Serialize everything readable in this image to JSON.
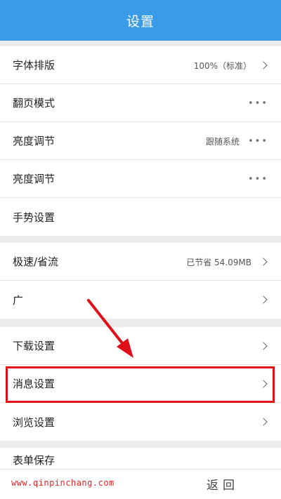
{
  "header": {
    "title": "设置"
  },
  "group1": [
    {
      "label": "字体排版",
      "value": "100%（标准）",
      "trail": "chevron-right"
    },
    {
      "label": "翻页模式",
      "value": "",
      "trail": "more"
    },
    {
      "label": "亮度调节",
      "value": "跟随系统",
      "trail": "more"
    },
    {
      "label": "亮度调节",
      "value": "",
      "trail": "more"
    },
    {
      "label": "手势设置",
      "value": "",
      "trail": ""
    }
  ],
  "group2": [
    {
      "label": "极速/省流",
      "value": "已节省 54.09MB",
      "trail": "chevron-right"
    },
    {
      "label": "广",
      "value": "",
      "trail": "chevron-right"
    }
  ],
  "group3": [
    {
      "label": "下载设置",
      "trail": "chevron-right"
    },
    {
      "label": "消息设置",
      "trail": "chevron-right"
    },
    {
      "label": "浏览设置",
      "trail": "chevron-right"
    }
  ],
  "group4": [
    {
      "label": "表单保存"
    }
  ],
  "more_glyph": "•••",
  "bottom": {
    "watermark": "www.qinpinchang.com",
    "back_label": "返回"
  },
  "colors": {
    "header_bg": "#3a9be6",
    "highlight": "#e0101a",
    "arrow": "#e0101a"
  }
}
